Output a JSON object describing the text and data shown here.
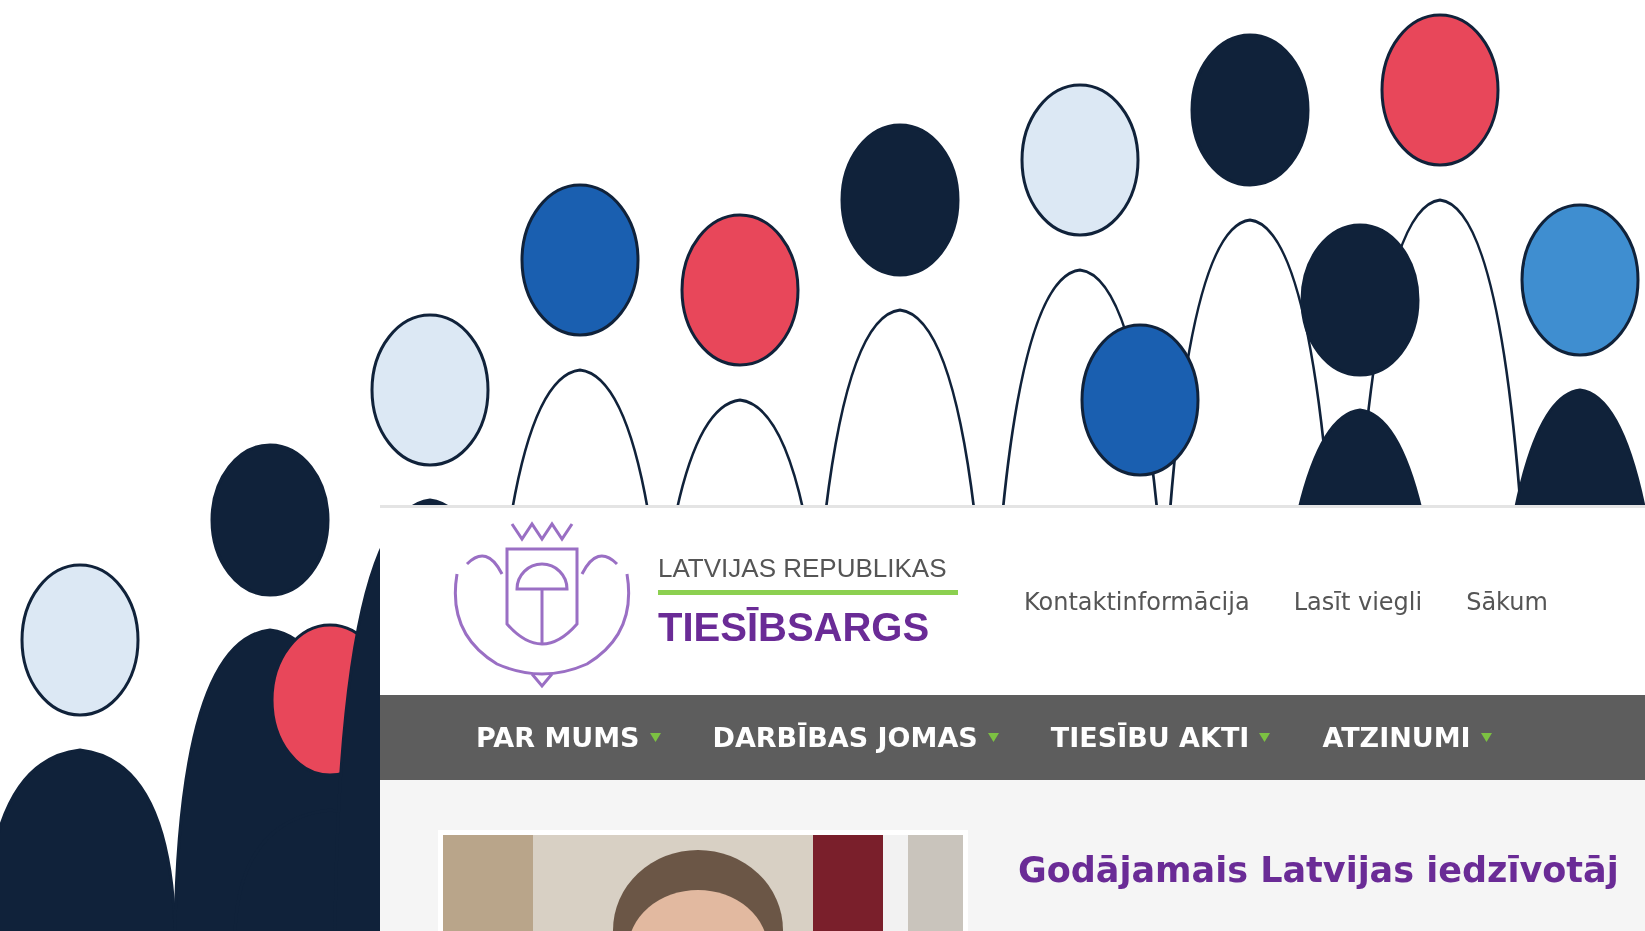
{
  "header": {
    "logo_line_1": "LATVIJAS REPUBLIKAS",
    "logo_line_2": "TIESĪBSARGS",
    "links": [
      "Kontaktinformācija",
      "Lasīt viegli",
      "Sākum"
    ]
  },
  "nav": [
    {
      "label": "PAR MUMS"
    },
    {
      "label": "DARBĪBAS JOMAS"
    },
    {
      "label": "TIESĪBU AKTI"
    },
    {
      "label": "ATZINUMI"
    }
  ],
  "article": {
    "title": "Godājamais Latvijas iedzīvotāj"
  }
}
